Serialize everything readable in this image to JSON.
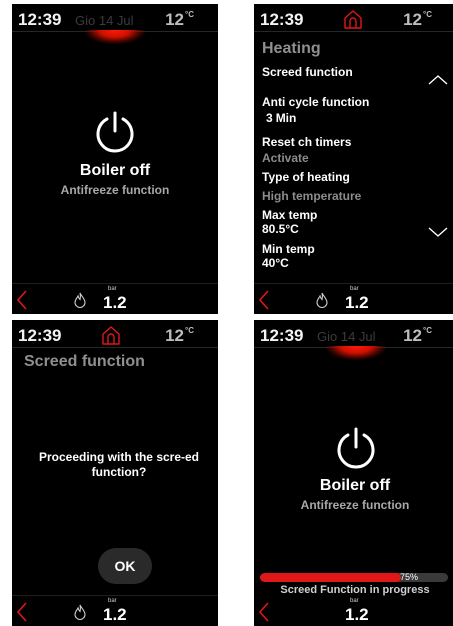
{
  "screens": {
    "s1": {
      "time": "12:39",
      "date": "Gio 14 Jul",
      "temp": "12",
      "temp_unit": "°C",
      "title": "Boiler off",
      "subtitle": "Antifreeze function",
      "pressure_unit": "bar",
      "pressure": "1.2"
    },
    "s2": {
      "time": "12:39",
      "temp": "12",
      "temp_unit": "°C",
      "heading": "Heating",
      "items": [
        {
          "label": "Screed function"
        },
        {
          "label": "Anti cycle function",
          "value_num": "3",
          "value_unit": "Min"
        },
        {
          "label": "Reset ch timers",
          "value": "Activate"
        },
        {
          "label": "Type of heating",
          "value": "High temperature"
        },
        {
          "label": "Max temp",
          "value": "80.5°C"
        },
        {
          "label": "Min temp",
          "value": "40°C"
        }
      ],
      "pressure_unit": "bar",
      "pressure": "1.2"
    },
    "s3": {
      "time": "12:39",
      "temp": "12",
      "temp_unit": "°C",
      "heading": "Screed function",
      "question": "Proceeding with the scre-ed function?",
      "ok_label": "OK",
      "pressure_unit": "bar",
      "pressure": "1.2"
    },
    "s4": {
      "time": "12:39",
      "date": "Gio 14 Jul",
      "temp": "12",
      "temp_unit": "°C",
      "title": "Boiler off",
      "subtitle": "Antifreeze function",
      "progress_value": 0.75,
      "progress_label": "75%",
      "progress_text": "Screed Function in progress",
      "pressure_unit": "bar",
      "pressure": "1.2"
    }
  },
  "colors": {
    "accent_red": "#e01717",
    "background": "#000000",
    "muted_text": "#8c8c8c"
  }
}
